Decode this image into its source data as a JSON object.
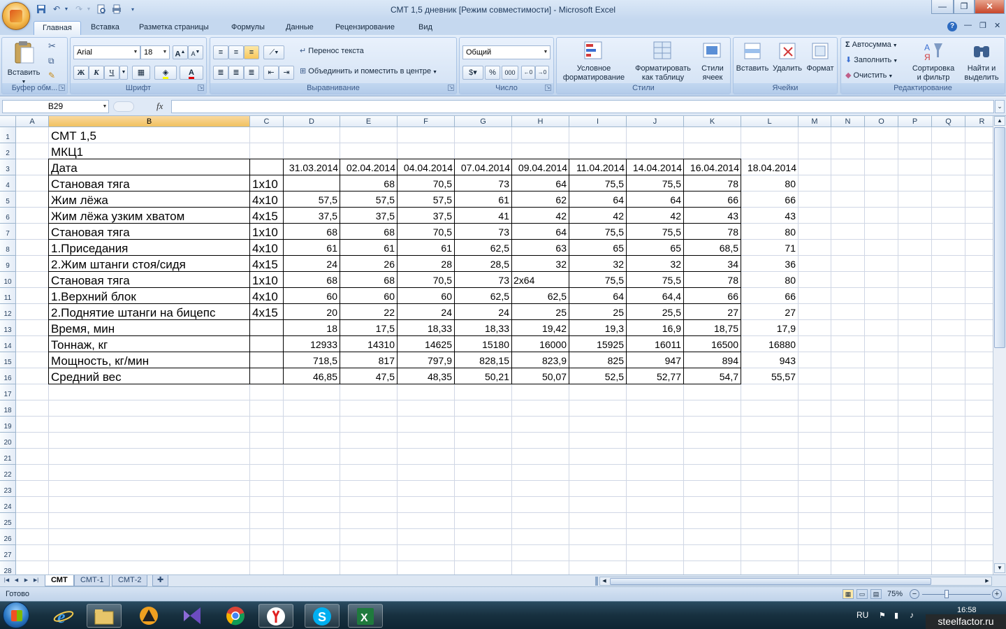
{
  "window": {
    "title": "СМТ 1,5 дневник  [Режим совместимости] - Microsoft Excel",
    "minimize": "—",
    "maximize": "❐",
    "close": "✕"
  },
  "ribbon_tabs": [
    "Главная",
    "Вставка",
    "Разметка страницы",
    "Формулы",
    "Данные",
    "Рецензирование",
    "Вид"
  ],
  "ribbon": {
    "clipboard": {
      "label": "Буфер обм...",
      "paste": "Вставить"
    },
    "font": {
      "label": "Шрифт",
      "font_name": "Arial",
      "font_size": "18",
      "bold": "Ж",
      "italic": "К",
      "underline": "Ч"
    },
    "alignment": {
      "label": "Выравнивание",
      "wrap": "Перенос текста",
      "merge": "Объединить и поместить в центре"
    },
    "number": {
      "label": "Число",
      "format": "Общий",
      "percent": "%",
      "thousands": "000"
    },
    "styles": {
      "label": "Стили",
      "conditional": [
        "Условное",
        "форматирование"
      ],
      "as_table": [
        "Форматировать",
        "как таблицу"
      ],
      "cell_styles": [
        "Стили",
        "ячеек"
      ]
    },
    "cells": {
      "label": "Ячейки",
      "insert": "Вставить",
      "delete": "Удалить",
      "format": "Формат"
    },
    "editing": {
      "label": "Редактирование",
      "autosum": "Автосумма",
      "fill": "Заполнить",
      "clear": "Очистить",
      "sort": [
        "Сортировка",
        "и фильтр"
      ],
      "find": [
        "Найти и",
        "выделить"
      ]
    }
  },
  "formula_bar": {
    "name_box": "B29",
    "fx": "fx",
    "value": ""
  },
  "columns": [
    "A",
    "B",
    "C",
    "D",
    "E",
    "F",
    "G",
    "H",
    "I",
    "J",
    "K",
    "L",
    "M",
    "N",
    "O",
    "P",
    "Q",
    "R"
  ],
  "rows": [
    "1",
    "2",
    "3",
    "4",
    "5",
    "6",
    "7",
    "8",
    "9",
    "10",
    "11",
    "12",
    "13",
    "14",
    "15",
    "16",
    "17",
    "18",
    "19",
    "20",
    "21",
    "22",
    "23",
    "24",
    "25",
    "26",
    "27",
    "28"
  ],
  "sheet": {
    "title1": "СМТ 1,5",
    "title2": "МКЦ1",
    "header_label": "Дата",
    "dates": [
      "31.03.2014",
      "02.04.2014",
      "04.04.2014",
      "07.04.2014",
      "09.04.2014",
      "11.04.2014",
      "14.04.2014",
      "16.04.2014",
      "18.04.2014"
    ],
    "table": [
      {
        "name": "Становая тяга",
        "set": "1x10",
        "vals": [
          "",
          "68",
          "70,5",
          "73",
          "64",
          "75,5",
          "75,5",
          "78",
          "80"
        ]
      },
      {
        "name": "Жим лёжа",
        "set": "4x10",
        "vals": [
          "57,5",
          "57,5",
          "57,5",
          "61",
          "62",
          "64",
          "64",
          "66",
          "66"
        ]
      },
      {
        "name": "Жим лёжа узким хватом",
        "set": "4x15",
        "vals": [
          "37,5",
          "37,5",
          "37,5",
          "41",
          "42",
          "42",
          "42",
          "43",
          "43"
        ]
      },
      {
        "name": "Становая тяга",
        "set": "1x10",
        "vals": [
          "68",
          "68",
          "70,5",
          "73",
          "64",
          "75,5",
          "75,5",
          "78",
          "80"
        ]
      },
      {
        "name": "1.Приседания",
        "set": "4x10",
        "vals": [
          "61",
          "61",
          "61",
          "62,5",
          "63",
          "65",
          "65",
          "68,5",
          "71"
        ]
      },
      {
        "name": "2.Жим штанги стоя/сидя",
        "set": "4x15",
        "vals": [
          "24",
          "26",
          "28",
          "28,5",
          "32",
          "32",
          "32",
          "34",
          "36"
        ]
      },
      {
        "name": "Становая тяга",
        "set": "1x10",
        "vals": [
          "68",
          "68",
          "70,5",
          "73",
          "2x64",
          "75,5",
          "75,5",
          "78",
          "80"
        ]
      },
      {
        "name": "1.Верхний блок",
        "set": "4x10",
        "vals": [
          "60",
          "60",
          "60",
          "62,5",
          "62,5",
          "64",
          "64,4",
          "66",
          "66"
        ]
      },
      {
        "name": "2.Поднятие штанги на бицепс",
        "set": "4x15",
        "vals": [
          "20",
          "22",
          "24",
          "24",
          "25",
          "25",
          "25,5",
          "27",
          "27"
        ]
      },
      {
        "name": "Время, мин",
        "set": "",
        "vals": [
          "18",
          "17,5",
          "18,33",
          "18,33",
          "19,42",
          "19,3",
          "16,9",
          "18,75",
          "17,9"
        ]
      },
      {
        "name": "Тоннаж, кг",
        "set": "",
        "vals": [
          "12933",
          "14310",
          "14625",
          "15180",
          "16000",
          "15925",
          "16011",
          "16500",
          "16880"
        ]
      },
      {
        "name": "Мощность, кг/мин",
        "set": "",
        "vals": [
          "718,5",
          "817",
          "797,9",
          "828,15",
          "823,9",
          "825",
          "947",
          "894",
          "943"
        ]
      },
      {
        "name": "Средний вес",
        "set": "",
        "vals": [
          "46,85",
          "47,5",
          "48,35",
          "50,21",
          "50,07",
          "52,5",
          "52,77",
          "54,7",
          "55,57"
        ]
      }
    ]
  },
  "sheet_tabs": [
    "СМТ",
    "СМТ-1",
    "СМТ-2"
  ],
  "status": {
    "ready": "Готово",
    "zoom": "75%"
  },
  "taskbar": {
    "lang": "RU",
    "time": "16:58"
  },
  "watermark": "steelfactor.ru",
  "colors": {
    "accent": "#c5d8ef",
    "selected_header": "#f1c15f",
    "gridline": "#d0d7e5",
    "taskbar": "#17303f"
  }
}
